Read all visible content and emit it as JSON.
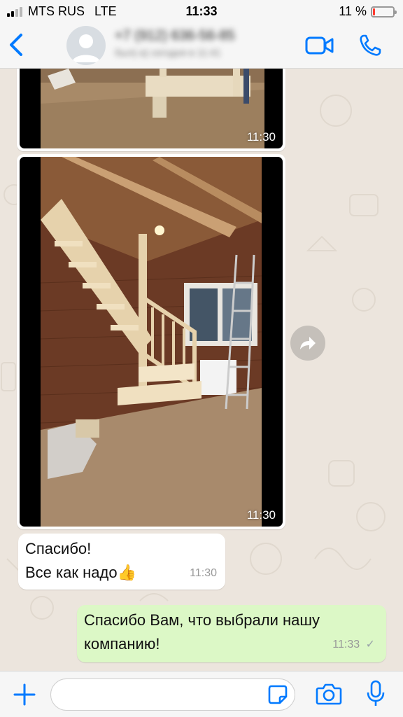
{
  "status_bar": {
    "carrier": "MTS RUS",
    "network": "LTE",
    "time": "11:33",
    "battery_percent": "11 %",
    "battery_level": 0.11,
    "battery_color": "#ff3b30"
  },
  "header": {
    "contact_name": "+7 (912) 636-56-85",
    "contact_subtitle": "был(-а) сегодня в 11:41",
    "back_icon": "chevron-left-icon",
    "video_icon": "video-camera-icon",
    "call_icon": "phone-icon",
    "accent": "#007aff"
  },
  "messages": [
    {
      "type": "image",
      "direction": "incoming",
      "time": "11:30",
      "content": "photo-staircase-bottom"
    },
    {
      "type": "image",
      "direction": "incoming",
      "time": "11:30",
      "content": "photo-wooden-staircase"
    },
    {
      "type": "text",
      "direction": "incoming",
      "line1": "Спасибо!",
      "line2": "Все как надо",
      "emoji": "👍",
      "time": "11:30"
    },
    {
      "type": "text",
      "direction": "outgoing",
      "line1": "Спасибо Вам, что выбрали нашу",
      "line2": "компанию!",
      "time": "11:33",
      "status": "✓"
    }
  ],
  "input_bar": {
    "placeholder": "",
    "plus_icon": "plus-icon",
    "sticker_icon": "sticker-icon",
    "camera_icon": "camera-icon",
    "mic_icon": "microphone-icon"
  },
  "colors": {
    "chat_background": "#ece5dd",
    "incoming_bubble": "#ffffff",
    "outgoing_bubble": "#dcf8c6",
    "check_color": "#9aa4a9"
  }
}
